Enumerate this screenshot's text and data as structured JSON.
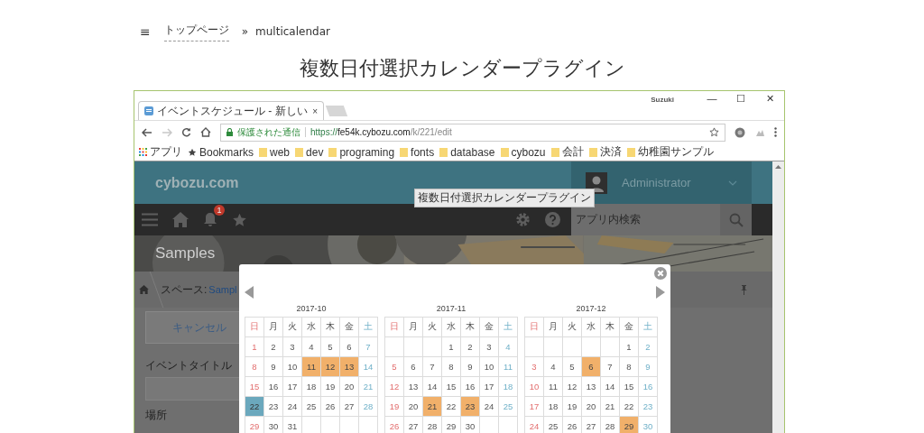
{
  "top_nav": {
    "menu_icon": "≡",
    "link": "トップページ",
    "separator": "»",
    "current": "multicalendar"
  },
  "page_title": "複数日付選択カレンダープラグイン",
  "browser": {
    "tab_title": "イベントスケジュール - 新しい",
    "tab_close": "×",
    "profile": "Suzuki",
    "window_buttons": [
      "—",
      "☐",
      "✕"
    ],
    "secure_label": "保護された通信",
    "url_scheme": "https://",
    "url_host": "fe54k.cybozu.com",
    "url_path": "/k/221/edit",
    "bookmarks": [
      {
        "label": "アプリ",
        "kind": "apps"
      },
      {
        "label": "Bookmarks",
        "kind": "star"
      },
      {
        "label": "web",
        "kind": "folder"
      },
      {
        "label": "dev",
        "kind": "folder"
      },
      {
        "label": "programing",
        "kind": "folder"
      },
      {
        "label": "fonts",
        "kind": "folder"
      },
      {
        "label": "database",
        "kind": "folder"
      },
      {
        "label": "cybozu",
        "kind": "folder"
      },
      {
        "label": "会計",
        "kind": "folder"
      },
      {
        "label": "決済",
        "kind": "folder"
      },
      {
        "label": "幼稚園サンプル",
        "kind": "folder"
      }
    ]
  },
  "app": {
    "logo": "cybozu.com",
    "user": "Administrator",
    "notification_count": "1",
    "search_placeholder": "アプリ内検索",
    "tooltip": "複数日付選択カレンダープラグイン",
    "space_title": "Samples",
    "breadcrumb": {
      "prefix": "スペース:",
      "link": "Sampl"
    },
    "cancel_button": "キャンセル",
    "fields": [
      {
        "label": "イベントタイトル",
        "kind": "text"
      },
      {
        "label": "場所",
        "kind": "label"
      }
    ]
  },
  "calendar_popup": {
    "months": [
      {
        "title": "2017-10",
        "weekdays": [
          {
            "label": "日",
            "kind": "sun"
          },
          {
            "label": "月",
            "kind": "day"
          },
          {
            "label": "火",
            "kind": "day"
          },
          {
            "label": "水",
            "kind": "day"
          },
          {
            "label": "木",
            "kind": "day"
          },
          {
            "label": "金",
            "kind": "day"
          },
          {
            "label": "土",
            "kind": "sat"
          }
        ],
        "weeks": [
          [
            {
              "d": "1",
              "selected": false,
              "today": false
            },
            {
              "d": "2",
              "selected": false,
              "today": false
            },
            {
              "d": "3",
              "selected": false,
              "today": false
            },
            {
              "d": "4",
              "selected": false,
              "today": false
            },
            {
              "d": "5",
              "selected": false,
              "today": false
            },
            {
              "d": "6",
              "selected": false,
              "today": false
            },
            {
              "d": "7",
              "selected": false,
              "today": false
            }
          ],
          [
            {
              "d": "8",
              "selected": false,
              "today": false
            },
            {
              "d": "9",
              "selected": false,
              "today": false
            },
            {
              "d": "10",
              "selected": false,
              "today": false
            },
            {
              "d": "11",
              "selected": true,
              "today": false
            },
            {
              "d": "12",
              "selected": true,
              "today": false
            },
            {
              "d": "13",
              "selected": true,
              "today": false
            },
            {
              "d": "14",
              "selected": false,
              "today": false
            }
          ],
          [
            {
              "d": "15",
              "selected": false,
              "today": false
            },
            {
              "d": "16",
              "selected": false,
              "today": false
            },
            {
              "d": "17",
              "selected": false,
              "today": false
            },
            {
              "d": "18",
              "selected": false,
              "today": false
            },
            {
              "d": "19",
              "selected": false,
              "today": false
            },
            {
              "d": "20",
              "selected": false,
              "today": false
            },
            {
              "d": "21",
              "selected": false,
              "today": false
            }
          ],
          [
            {
              "d": "22",
              "selected": false,
              "today": true
            },
            {
              "d": "23",
              "selected": false,
              "today": false
            },
            {
              "d": "24",
              "selected": false,
              "today": false
            },
            {
              "d": "25",
              "selected": false,
              "today": false
            },
            {
              "d": "26",
              "selected": false,
              "today": false
            },
            {
              "d": "27",
              "selected": false,
              "today": false
            },
            {
              "d": "28",
              "selected": false,
              "today": false
            }
          ],
          [
            {
              "d": "29",
              "selected": false,
              "today": false
            },
            {
              "d": "30",
              "selected": false,
              "today": false
            },
            {
              "d": "31",
              "selected": false,
              "today": false
            }
          ]
        ]
      },
      {
        "title": "2017-11",
        "weekdays": [
          {
            "label": "日",
            "kind": "sun"
          },
          {
            "label": "月",
            "kind": "day"
          },
          {
            "label": "火",
            "kind": "day"
          },
          {
            "label": "水",
            "kind": "day"
          },
          {
            "label": "木",
            "kind": "day"
          },
          {
            "label": "金",
            "kind": "day"
          },
          {
            "label": "土",
            "kind": "sat"
          }
        ],
        "weeks": [
          [
            {
              "d": "1",
              "selected": false,
              "today": false
            },
            {
              "d": "2",
              "selected": false,
              "today": false
            },
            {
              "d": "3",
              "selected": false,
              "today": false
            },
            {
              "d": "4",
              "selected": false,
              "today": false
            }
          ],
          [
            {
              "d": "5",
              "selected": false,
              "today": false
            },
            {
              "d": "6",
              "selected": false,
              "today": false
            },
            {
              "d": "7",
              "selected": false,
              "today": false
            },
            {
              "d": "8",
              "selected": false,
              "today": false
            },
            {
              "d": "9",
              "selected": false,
              "today": false
            },
            {
              "d": "10",
              "selected": false,
              "today": false
            },
            {
              "d": "11",
              "selected": false,
              "today": false
            }
          ],
          [
            {
              "d": "12",
              "selected": false,
              "today": false
            },
            {
              "d": "13",
              "selected": false,
              "today": false
            },
            {
              "d": "14",
              "selected": false,
              "today": false
            },
            {
              "d": "15",
              "selected": false,
              "today": false
            },
            {
              "d": "16",
              "selected": false,
              "today": false
            },
            {
              "d": "17",
              "selected": false,
              "today": false
            },
            {
              "d": "18",
              "selected": false,
              "today": false
            }
          ],
          [
            {
              "d": "19",
              "selected": false,
              "today": false
            },
            {
              "d": "20",
              "selected": false,
              "today": false
            },
            {
              "d": "21",
              "selected": true,
              "today": false
            },
            {
              "d": "22",
              "selected": false,
              "today": false
            },
            {
              "d": "23",
              "selected": true,
              "today": false
            },
            {
              "d": "24",
              "selected": false,
              "today": false
            },
            {
              "d": "25",
              "selected": false,
              "today": false
            }
          ],
          [
            {
              "d": "26",
              "selected": false,
              "today": false
            },
            {
              "d": "27",
              "selected": false,
              "today": false
            },
            {
              "d": "28",
              "selected": false,
              "today": false
            },
            {
              "d": "29",
              "selected": false,
              "today": false
            },
            {
              "d": "30",
              "selected": false,
              "today": false
            }
          ]
        ]
      },
      {
        "title": "2017-12",
        "weekdays": [
          {
            "label": "日",
            "kind": "sun"
          },
          {
            "label": "月",
            "kind": "day"
          },
          {
            "label": "火",
            "kind": "day"
          },
          {
            "label": "水",
            "kind": "day"
          },
          {
            "label": "木",
            "kind": "day"
          },
          {
            "label": "金",
            "kind": "day"
          },
          {
            "label": "土",
            "kind": "sat"
          }
        ],
        "weeks": [
          [
            {
              "d": "1",
              "selected": false,
              "today": false
            },
            {
              "d": "2",
              "selected": false,
              "today": false
            }
          ],
          [
            {
              "d": "3",
              "selected": false,
              "today": false
            },
            {
              "d": "4",
              "selected": false,
              "today": false
            },
            {
              "d": "5",
              "selected": false,
              "today": false
            },
            {
              "d": "6",
              "selected": true,
              "today": false
            },
            {
              "d": "7",
              "selected": false,
              "today": false
            },
            {
              "d": "8",
              "selected": false,
              "today": false
            },
            {
              "d": "9",
              "selected": false,
              "today": false
            }
          ],
          [
            {
              "d": "10",
              "selected": false,
              "today": false
            },
            {
              "d": "11",
              "selected": false,
              "today": false
            },
            {
              "d": "12",
              "selected": false,
              "today": false
            },
            {
              "d": "13",
              "selected": false,
              "today": false
            },
            {
              "d": "14",
              "selected": false,
              "today": false
            },
            {
              "d": "15",
              "selected": false,
              "today": false
            },
            {
              "d": "16",
              "selected": false,
              "today": false
            }
          ],
          [
            {
              "d": "17",
              "selected": false,
              "today": false
            },
            {
              "d": "18",
              "selected": false,
              "today": false
            },
            {
              "d": "19",
              "selected": false,
              "today": false
            },
            {
              "d": "20",
              "selected": false,
              "today": false
            },
            {
              "d": "21",
              "selected": false,
              "today": false
            },
            {
              "d": "22",
              "selected": false,
              "today": false
            },
            {
              "d": "23",
              "selected": false,
              "today": false
            }
          ],
          [
            {
              "d": "24",
              "selected": false,
              "today": false
            },
            {
              "d": "25",
              "selected": false,
              "today": false
            },
            {
              "d": "26",
              "selected": false,
              "today": false
            },
            {
              "d": "27",
              "selected": false,
              "today": false
            },
            {
              "d": "28",
              "selected": false,
              "today": false
            },
            {
              "d": "29",
              "selected": true,
              "today": false
            },
            {
              "d": "30",
              "selected": false,
              "today": false
            }
          ]
        ]
      }
    ]
  }
}
